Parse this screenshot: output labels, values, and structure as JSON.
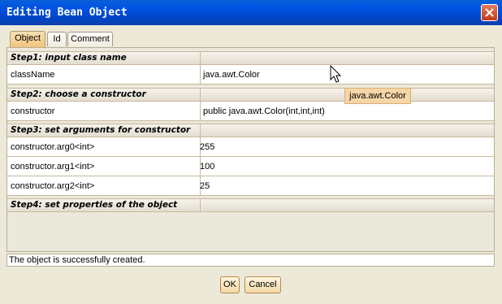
{
  "window": {
    "title": "Editing Bean Object"
  },
  "tabs": [
    {
      "label": "Object",
      "active": true
    },
    {
      "label": "Id",
      "active": false
    },
    {
      "label": "Comment",
      "active": false
    }
  ],
  "sections": {
    "step1": "Step1: input class name",
    "step2": "Step2: choose a constructor",
    "step3": "Step3: set arguments for constructor",
    "step4": "Step4: set properties of the object"
  },
  "properties": {
    "class_name": {
      "key": "className",
      "value": "java.awt.Color"
    },
    "constructor": {
      "key": "constructor",
      "value": "public java.awt.Color(int,int,int)"
    },
    "arg0": {
      "key": "constructor.arg0<int>",
      "value": "255"
    },
    "arg1": {
      "key": "constructor.arg1<int>",
      "value": "100"
    },
    "arg2": {
      "key": "constructor.arg2<int>",
      "value": "25"
    }
  },
  "tooltip": "java.awt.Color",
  "status": "The object is successfully created.",
  "buttons": {
    "ok": "OK",
    "cancel": "Cancel"
  },
  "icons": {
    "close": "close-icon",
    "cursor": "mouse-pointer-icon"
  },
  "colors": {
    "title_bar": "#0054e3",
    "active_tab": "#f1c57d",
    "tooltip_bg": "#f6d5a6",
    "section_bg": "#e3ddcf"
  }
}
